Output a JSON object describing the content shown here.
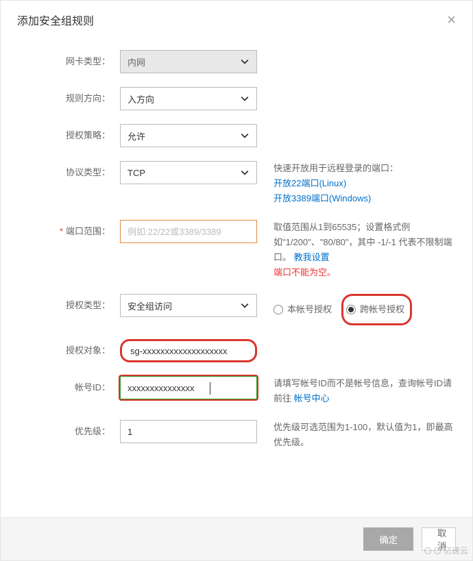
{
  "title": "添加安全组规则",
  "labels": {
    "nicType": "网卡类型：",
    "direction": "规则方向：",
    "policy": "授权策略：",
    "protocol": "协议类型：",
    "portRange": "端口范围：",
    "authType": "授权类型：",
    "authTarget": "授权对象：",
    "accountId": "帐号ID：",
    "priority": "优先级："
  },
  "values": {
    "nicType": "内网",
    "direction": "入方向",
    "policy": "允许",
    "protocol": "TCP",
    "portRangePlaceholder": "例如:22/22或3389/3389",
    "authType": "安全组访问",
    "authTarget": "sg-xxxxxxxxxxxxxxxxxxx",
    "accountId": "xxxxxxxxxxxxxxx",
    "priority": "1"
  },
  "hints": {
    "protocolTitle": "快速开放用于远程登录的端口：",
    "open22": "开放22端口(Linux)",
    "open3389": "开放3389端口(Windows)",
    "portRangeText1": "取值范围从1到65535；设置格式例如\"1/200\"、\"80/80\"，其中 -1/-1 代表不限制端口。 ",
    "portRangeLink": "教我设置",
    "portErr": "端口不能为空。",
    "accountIdText": "请填写帐号ID而不是帐号信息，查询帐号ID请前往 ",
    "accountIdLink": "帐号中心",
    "priorityText": "优先级可选范围为1-100，默认值为1，即最高优先级。"
  },
  "radios": {
    "sameAccount": "本帐号授权",
    "crossAccount": "跨帐号授权"
  },
  "buttons": {
    "ok": "确定",
    "cancel": "取消"
  },
  "watermark": "亿速云"
}
